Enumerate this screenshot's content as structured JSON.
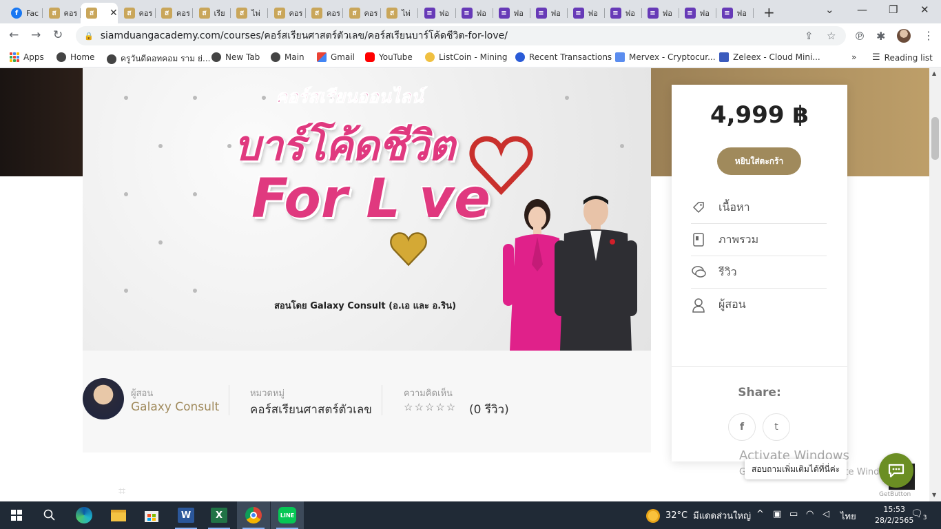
{
  "browser": {
    "tabs": [
      {
        "icon": "facebook-icon",
        "label": "Fac"
      },
      {
        "icon": "siamduang-icon",
        "label": "คอร"
      },
      {
        "icon": "siamduang-icon",
        "label": "",
        "active": true
      },
      {
        "icon": "siamduang-icon",
        "label": "คอร"
      },
      {
        "icon": "siamduang-icon",
        "label": "คอร"
      },
      {
        "icon": "siamduang-icon",
        "label": "เรีย"
      },
      {
        "icon": "siamduang-icon",
        "label": "ไพ่"
      },
      {
        "icon": "siamduang-icon",
        "label": "คอร"
      },
      {
        "icon": "siamduang-icon",
        "label": "คอร"
      },
      {
        "icon": "siamduang-icon",
        "label": "คอร"
      },
      {
        "icon": "siamduang-icon",
        "label": "ไพ่"
      },
      {
        "icon": "forms-icon",
        "label": "ฟอ"
      },
      {
        "icon": "forms-icon",
        "label": "ฟอ"
      },
      {
        "icon": "forms-icon",
        "label": "ฟอ"
      },
      {
        "icon": "forms-icon",
        "label": "ฟอ"
      },
      {
        "icon": "forms-icon",
        "label": "ฟอ"
      },
      {
        "icon": "forms-icon",
        "label": "ฟอ"
      },
      {
        "icon": "forms-icon",
        "label": "ฟอ"
      },
      {
        "icon": "forms-icon",
        "label": "ฟอ"
      },
      {
        "icon": "forms-icon",
        "label": "ฟอ"
      }
    ],
    "close_glyph": "✕",
    "new_tab_glyph": "+",
    "url": "siamduangacademy.com/courses/คอร์สเรียนศาสตร์ตัวเลข/คอร์สเรียนบาร์โค้ดชีวิต-for-love/",
    "bookmarks": [
      {
        "label": "Apps",
        "icon": "apps-grid-icon"
      },
      {
        "label": "Home",
        "icon": "globe-icon"
      },
      {
        "label": "ครูวันดีดอทคอม ราม ย่...",
        "icon": "globe-icon"
      },
      {
        "label": "New Tab",
        "icon": "globe-icon"
      },
      {
        "label": "Main",
        "icon": "globe-icon"
      },
      {
        "label": "Gmail",
        "icon": "gmail-icon"
      },
      {
        "label": "YouTube",
        "icon": "youtube-icon"
      },
      {
        "label": "ListCoin - Mining",
        "icon": "listcoin-icon"
      },
      {
        "label": "Recent Transactions",
        "icon": "coin-icon"
      },
      {
        "label": "Mervex - Cryptocur...",
        "icon": "mervex-icon"
      },
      {
        "label": "Zeleex - Cloud Mini...",
        "icon": "zeleex-icon"
      }
    ],
    "bookmarks_overflow": "»",
    "reading_list": "Reading list"
  },
  "banner": {
    "subtitle": "คอร์สเรียนออนไลน์",
    "title": "บาร์โค้ดชีวิต",
    "title_line2": "For L ve",
    "credit": "สอนโดย Galaxy Consult (อ.เอ และ อ.ริน)"
  },
  "course_meta": {
    "instructor_label": "ผู้สอน",
    "instructor_name": "Galaxy Consult",
    "category_label": "หมวดหมู่",
    "category_value": "คอร์สเรียนศาสตร์ตัวเลข",
    "reviews_label": "ความคิดเห็น",
    "stars": "☆☆☆☆☆",
    "rating": 0,
    "reviews_text": "(0 รีวิว)"
  },
  "sidebar": {
    "price": "4,999 ฿",
    "add_to_cart": "หยิบใส่ตะกร้า",
    "nav_items": [
      {
        "label": "เนื้อหา",
        "icon": "tag-icon"
      },
      {
        "label": "ภาพรวม",
        "icon": "document-icon"
      },
      {
        "label": "รีวิว",
        "icon": "chat-bubbles-icon"
      },
      {
        "label": "ผู้สอน",
        "icon": "user-icon"
      }
    ],
    "share_label": "Share:",
    "share_facebook": "f",
    "share_twitter": "t"
  },
  "watermark": {
    "title": "Activate Windows",
    "subtitle": "Go to Settings to activate Windows."
  },
  "chat": {
    "tooltip": "สอบถามเพิ่มเติมได้ที่นี่ค่ะ",
    "getbutton": "GetButton"
  },
  "taskbar": {
    "apps": [
      "windows-start-icon",
      "search-icon",
      "edge-icon",
      "file-explorer-icon",
      "store-icon",
      "word-icon",
      "excel-icon",
      "chrome-icon",
      "line-icon"
    ],
    "temperature": "32°C",
    "weather_text": "มีแดดส่วนใหญ่",
    "language": "ไทย",
    "time": "15:53",
    "date": "28/2/2565",
    "notifications": "3"
  },
  "colors": {
    "accent_gold": "#a08a5c",
    "banner_pink": "#e0397f",
    "chat_green": "#6b8e23",
    "taskbar": "#202a36"
  }
}
